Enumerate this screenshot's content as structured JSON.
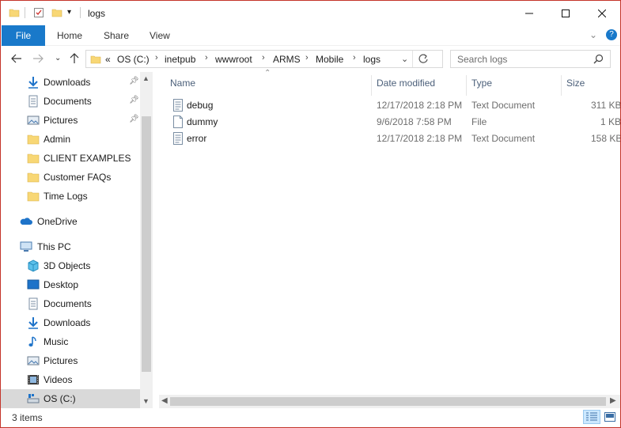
{
  "window": {
    "title": "logs"
  },
  "ribbon": {
    "tabs": [
      "File",
      "Home",
      "Share",
      "View"
    ]
  },
  "address": {
    "overflow": "«",
    "crumbs": [
      "OS (C:)",
      "inetpub",
      "wwwroot",
      "ARMS",
      "Mobile",
      "logs"
    ],
    "separator": "›"
  },
  "search": {
    "placeholder": "Search logs"
  },
  "nav": {
    "quick_access": [
      {
        "label": "Downloads",
        "icon": "downloads-icon",
        "pinned": true
      },
      {
        "label": "Documents",
        "icon": "documents-icon",
        "pinned": true
      },
      {
        "label": "Pictures",
        "icon": "pictures-icon",
        "pinned": true
      },
      {
        "label": "Admin",
        "icon": "folder-icon",
        "pinned": false
      },
      {
        "label": "CLIENT EXAMPLES",
        "icon": "folder-icon",
        "pinned": false
      },
      {
        "label": "Customer FAQs",
        "icon": "folder-icon",
        "pinned": false
      },
      {
        "label": "Time Logs",
        "icon": "folder-icon",
        "pinned": false
      }
    ],
    "onedrive": "OneDrive",
    "this_pc": "This PC",
    "pc_items": [
      {
        "label": "3D Objects",
        "icon": "3d-objects-icon"
      },
      {
        "label": "Desktop",
        "icon": "desktop-icon"
      },
      {
        "label": "Documents",
        "icon": "documents-icon"
      },
      {
        "label": "Downloads",
        "icon": "downloads-icon"
      },
      {
        "label": "Music",
        "icon": "music-icon"
      },
      {
        "label": "Pictures",
        "icon": "pictures-icon"
      },
      {
        "label": "Videos",
        "icon": "videos-icon"
      },
      {
        "label": "OS (C:)",
        "icon": "drive-icon",
        "selected": true
      }
    ]
  },
  "columns": {
    "name": "Name",
    "date": "Date modified",
    "type": "Type",
    "size": "Size"
  },
  "files": [
    {
      "name": "debug",
      "date": "12/17/2018 2:18 PM",
      "type": "Text Document",
      "size": "311 KB",
      "icon": "text-file-icon"
    },
    {
      "name": "dummy",
      "date": "9/6/2018 7:58 PM",
      "type": "File",
      "size": "1 KB",
      "icon": "file-icon"
    },
    {
      "name": "error",
      "date": "12/17/2018 2:18 PM",
      "type": "Text Document",
      "size": "158 KB",
      "icon": "text-file-icon"
    }
  ],
  "status": {
    "items": "3 items"
  },
  "colors": {
    "file_tab": "#1979ca",
    "window_border": "#c4342a",
    "folder": "#f8d775",
    "header_text": "#4c607a"
  }
}
